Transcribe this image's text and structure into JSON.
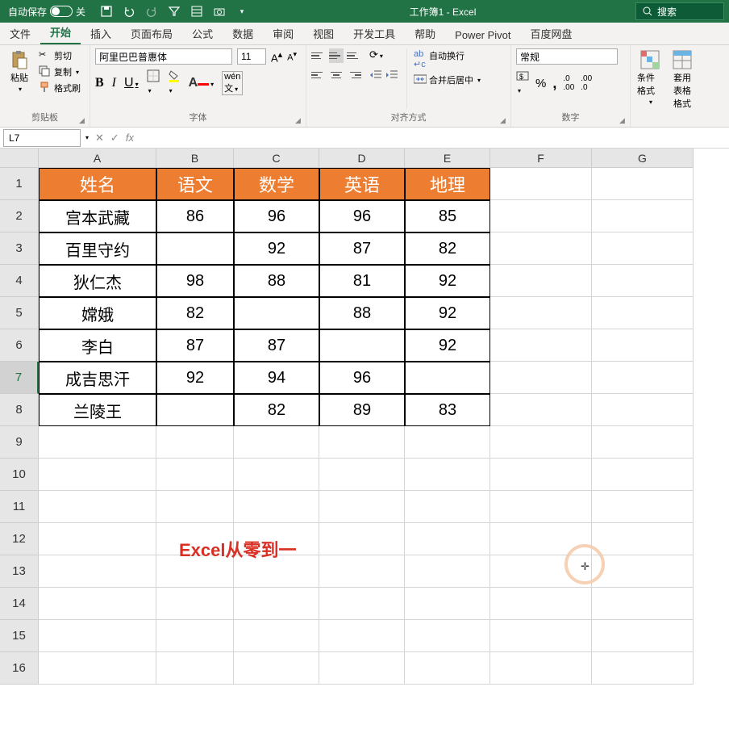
{
  "titlebar": {
    "autosave": "自动保存",
    "autosave_state": "关",
    "title": "工作簿1 - Excel",
    "search": "搜索"
  },
  "tabs": [
    "文件",
    "开始",
    "插入",
    "页面布局",
    "公式",
    "数据",
    "审阅",
    "视图",
    "开发工具",
    "帮助",
    "Power Pivot",
    "百度网盘"
  ],
  "active_tab": 1,
  "ribbon": {
    "clipboard": {
      "paste": "粘贴",
      "cut": "剪切",
      "copy": "复制",
      "fmtpainter": "格式刷",
      "label": "剪贴板"
    },
    "font": {
      "name": "阿里巴巴普惠体",
      "size": "11",
      "bold": "B",
      "italic": "I",
      "underline": "U",
      "label": "字体"
    },
    "align": {
      "wrap": "自动换行",
      "merge": "合并后居中",
      "label": "对齐方式"
    },
    "number": {
      "fmt": "常规",
      "label": "数字"
    },
    "styles": {
      "condfmt": "条件格式",
      "tablefmt": "套用\n表格格式"
    }
  },
  "fxbar": {
    "namebox": "L7",
    "formula": ""
  },
  "grid": {
    "cols": [
      {
        "l": "A",
        "w": 146
      },
      {
        "l": "B",
        "w": 96
      },
      {
        "l": "C",
        "w": 106
      },
      {
        "l": "D",
        "w": 106
      },
      {
        "l": "E",
        "w": 106
      },
      {
        "l": "F",
        "w": 126
      },
      {
        "l": "G",
        "w": 126
      }
    ],
    "rows": 16,
    "selected_row": 7,
    "headers": [
      "姓名",
      "语文",
      "数学",
      "英语",
      "地理"
    ],
    "data": [
      [
        "宫本武藏",
        "86",
        "96",
        "96",
        "85"
      ],
      [
        "百里守约",
        "",
        "92",
        "87",
        "82"
      ],
      [
        "狄仁杰",
        "98",
        "88",
        "81",
        "92"
      ],
      [
        "嫦娥",
        "82",
        "",
        "88",
        "92"
      ],
      [
        "李白",
        "87",
        "87",
        "",
        "92"
      ],
      [
        "成吉思汗",
        "92",
        "94",
        "96",
        ""
      ],
      [
        "兰陵王",
        "",
        "82",
        "89",
        "83"
      ]
    ],
    "watermark": "Excel从零到一"
  }
}
